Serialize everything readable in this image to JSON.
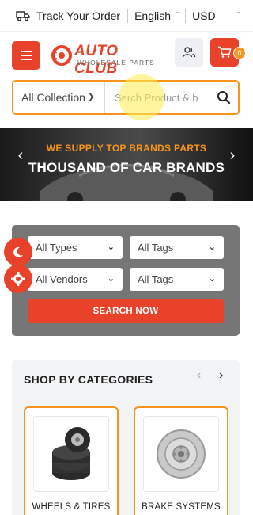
{
  "topbar": {
    "track_icon": "truck-icon",
    "track_label": "Track Your Order",
    "language": "English",
    "currency": "USD"
  },
  "header": {
    "logo_text": "AUTO CLUB",
    "logo_sub": "WHOLESALE PARTS",
    "menu_icon": "hamburger-icon",
    "user_icon": "users-icon",
    "cart_icon": "cart-icon",
    "cart_count": "0"
  },
  "search": {
    "collection": "All Collection",
    "placeholder": "Serch Product & b",
    "icon": "search-icon"
  },
  "banner": {
    "subtitle": "WE SUPPLY TOP BRANDS PARTS",
    "title": "THOUSAND OF CAR BRANDS",
    "prev": "‹",
    "next": "›"
  },
  "filter": {
    "types": "All Types",
    "tags1": "All Tags",
    "vendors": "All Vendors",
    "tags2": "All Tags",
    "button": "SEARCH NOW"
  },
  "floating": {
    "theme_icon": "moon-icon",
    "settings_icon": "gear-icon"
  },
  "categories": {
    "title": "SHOP BY CATEGORIES",
    "prev": "‹",
    "next": "›",
    "items": [
      {
        "label": "WHEELS & TIRES",
        "icon": "tires-icon"
      },
      {
        "label": "BRAKE SYSTEMS",
        "icon": "brake-disc-icon"
      }
    ]
  },
  "colors": {
    "accent": "#e8432a",
    "secondary": "#f7941d"
  }
}
